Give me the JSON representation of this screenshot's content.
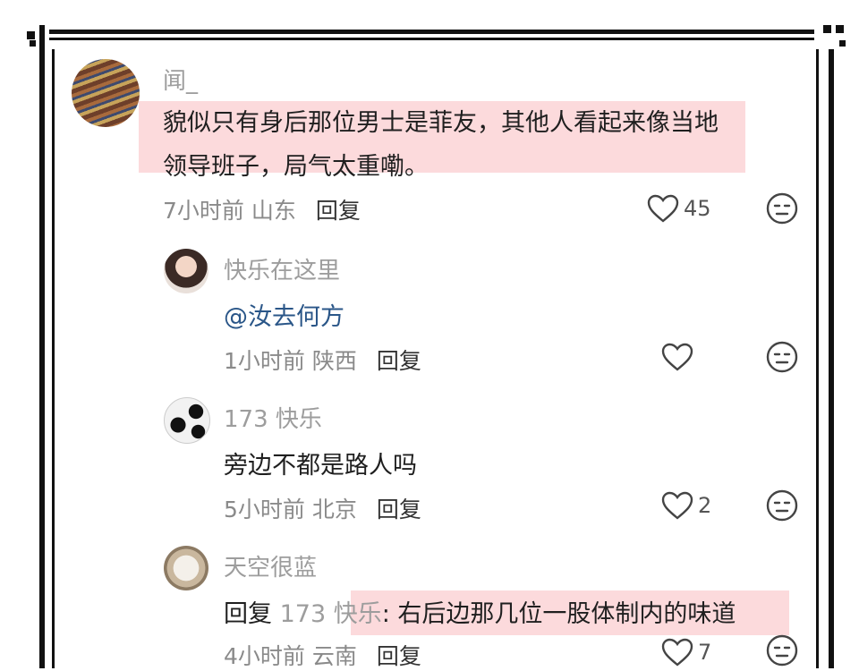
{
  "comments": [
    {
      "username": "闻_",
      "line1": "貌似只有身后那位男士是菲友，其他人看起来像当地",
      "line2": "领导班子，局气太重嘞。",
      "time": "7小时前",
      "location": "山东",
      "reply": "回复",
      "likes": "45"
    },
    {
      "username": "快乐在这里",
      "text": "@汝去何方",
      "time": "1小时前",
      "location": "陕西",
      "reply": "回复",
      "likes": ""
    },
    {
      "username": "173 快乐",
      "text": "旁边不都是路人吗",
      "time": "5小时前",
      "location": "北京",
      "reply": "回复",
      "likes": "2"
    },
    {
      "username": "天空很蓝",
      "reply_prefix": "回复",
      "reply_target": "173 快乐",
      "text": ": 右后边那几位一股体制内的味道",
      "time": "4小时前",
      "location": "云南",
      "reply": "回复",
      "likes": "7"
    }
  ],
  "colors": {
    "highlight": "#fcd3d6",
    "mention": "#2a5688"
  },
  "icons": [
    "heart-icon",
    "neutral-face-icon"
  ]
}
